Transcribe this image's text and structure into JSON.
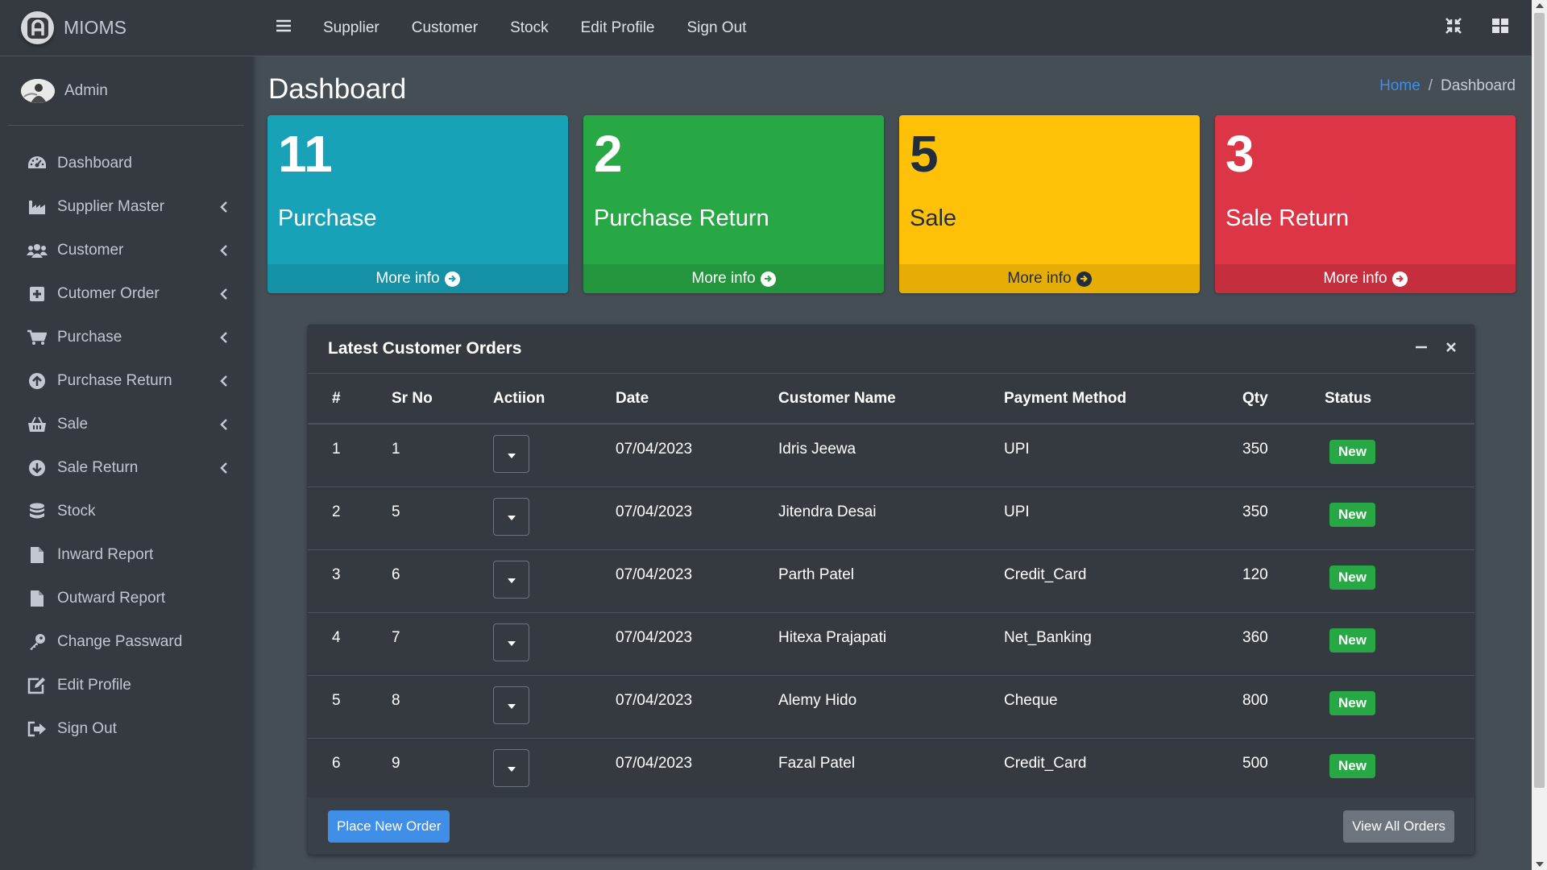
{
  "brand": {
    "name": "MIOMS"
  },
  "user": {
    "name": "Admin"
  },
  "sidebar": {
    "items": [
      {
        "label": "Dashboard",
        "icon": "dashboard-icon",
        "has_submenu": false
      },
      {
        "label": "Supplier Master",
        "icon": "industry-icon",
        "has_submenu": true
      },
      {
        "label": "Customer",
        "icon": "users-icon",
        "has_submenu": true
      },
      {
        "label": "Cutomer Order",
        "icon": "plus-square-icon",
        "has_submenu": true
      },
      {
        "label": "Purchase",
        "icon": "cart-icon",
        "has_submenu": true
      },
      {
        "label": "Purchase Return",
        "icon": "arrow-circle-up-icon",
        "has_submenu": true
      },
      {
        "label": "Sale",
        "icon": "basket-icon",
        "has_submenu": true
      },
      {
        "label": "Sale Return",
        "icon": "arrow-circle-down-icon",
        "has_submenu": true
      },
      {
        "label": "Stock",
        "icon": "database-icon",
        "has_submenu": false
      },
      {
        "label": "Inward Report",
        "icon": "file-icon",
        "has_submenu": false
      },
      {
        "label": "Outward Report",
        "icon": "file-icon",
        "has_submenu": false
      },
      {
        "label": "Change Passward",
        "icon": "key-icon",
        "has_submenu": false
      },
      {
        "label": "Edit Profile",
        "icon": "edit-icon",
        "has_submenu": false
      },
      {
        "label": "Sign Out",
        "icon": "sign-out-icon",
        "has_submenu": false
      }
    ]
  },
  "topnav": {
    "links": [
      "Supplier",
      "Customer",
      "Stock",
      "Edit Profile",
      "Sign Out"
    ]
  },
  "page": {
    "title": "Dashboard",
    "breadcrumb": {
      "home": "Home",
      "separator": "/",
      "current": "Dashboard"
    }
  },
  "stats": [
    {
      "value": "11",
      "label": "Purchase",
      "more": "More info",
      "color": "#17a2b8"
    },
    {
      "value": "2",
      "label": "Purchase Return",
      "more": "More info",
      "color": "#28a745"
    },
    {
      "value": "5",
      "label": "Sale",
      "more": "More info",
      "color": "#ffc107"
    },
    {
      "value": "3",
      "label": "Sale Return",
      "more": "More info",
      "color": "#dc3545"
    }
  ],
  "orders": {
    "title": "Latest Customer Orders",
    "columns": [
      "#",
      "Sr No",
      "Actiion",
      "Date",
      "Customer Name",
      "Payment Method",
      "Qty",
      "Status"
    ],
    "rows": [
      {
        "idx": "1",
        "sr": "1",
        "date": "07/04/2023",
        "customer": "Idris Jeewa",
        "payment": "UPI",
        "qty": "350",
        "status": "New"
      },
      {
        "idx": "2",
        "sr": "5",
        "date": "07/04/2023",
        "customer": "Jitendra Desai",
        "payment": "UPI",
        "qty": "350",
        "status": "New"
      },
      {
        "idx": "3",
        "sr": "6",
        "date": "07/04/2023",
        "customer": "Parth Patel",
        "payment": "Credit_Card",
        "qty": "120",
        "status": "New"
      },
      {
        "idx": "4",
        "sr": "7",
        "date": "07/04/2023",
        "customer": "Hitexa Prajapati",
        "payment": "Net_Banking",
        "qty": "360",
        "status": "New"
      },
      {
        "idx": "5",
        "sr": "8",
        "date": "07/04/2023",
        "customer": "Alemy Hido",
        "payment": "Cheque",
        "qty": "800",
        "status": "New"
      },
      {
        "idx": "6",
        "sr": "9",
        "date": "07/04/2023",
        "customer": "Fazal Patel",
        "payment": "Credit_Card",
        "qty": "500",
        "status": "New"
      }
    ],
    "place_order_label": "Place New Order",
    "view_all_label": "View All Orders"
  },
  "colors": {
    "sidebar_bg": "#343a40",
    "content_bg": "#454d55",
    "link_blue": "#3f8ee8",
    "badge_green": "#28a745"
  }
}
